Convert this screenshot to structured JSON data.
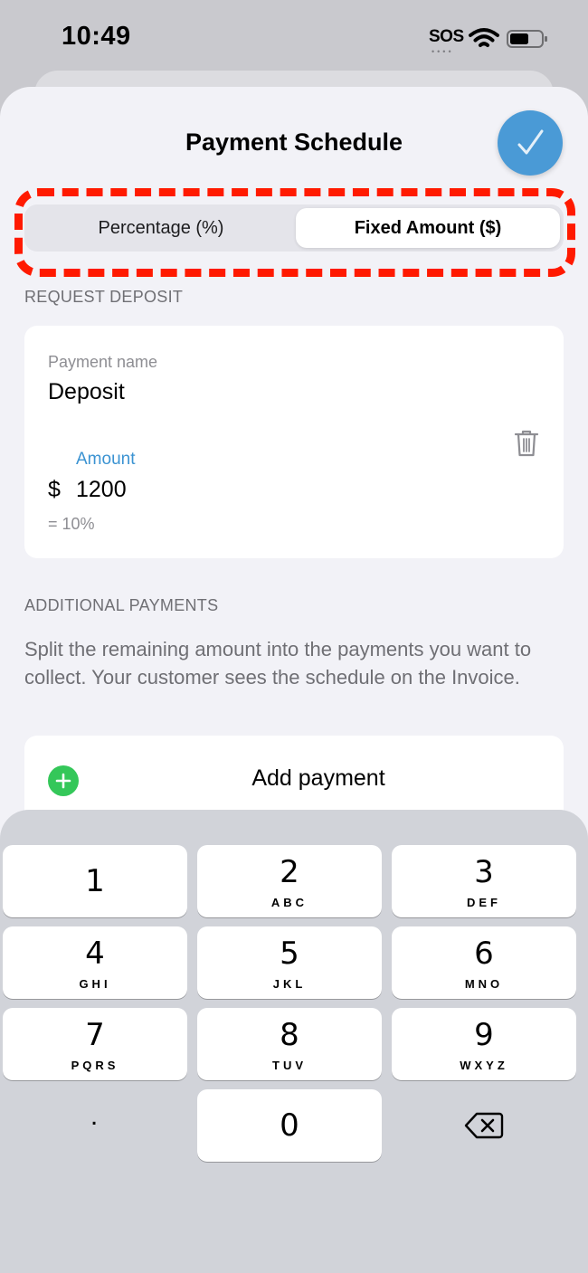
{
  "status_bar": {
    "time": "10:49",
    "sos": "SOS",
    "dots": "••••",
    "wifi_icon": "wifi-icon",
    "battery_icon": "battery-icon"
  },
  "sheet": {
    "title": "Payment Schedule",
    "done_icon": "checkmark-icon",
    "accent_color": "#4a9ad6"
  },
  "segmented_control": {
    "options": [
      "Percentage (%)",
      "Fixed Amount ($)"
    ],
    "selected": "Fixed Amount ($)",
    "highlight_color": "#ff1a00"
  },
  "request_deposit": {
    "header": "REQUEST DEPOSIT",
    "name_label": "Payment name",
    "name_value": "Deposit",
    "amount_label": "Amount",
    "currency": "$",
    "amount_value": "1200",
    "percent_note": "= 10%",
    "delete_icon": "trash-icon"
  },
  "additional_payments": {
    "header": "ADDITIONAL PAYMENTS",
    "description": "Split the remaining amount into the payments you want to collect. Your customer sees the schedule on the Invoice.",
    "add_label": "Add payment",
    "add_icon": "plus-circle-icon",
    "add_color": "#34c759"
  },
  "keypad": {
    "keys": [
      {
        "digit": "1",
        "letters": ""
      },
      {
        "digit": "2",
        "letters": "ABC"
      },
      {
        "digit": "3",
        "letters": "DEF"
      },
      {
        "digit": "4",
        "letters": "GHI"
      },
      {
        "digit": "5",
        "letters": "JKL"
      },
      {
        "digit": "6",
        "letters": "MNO"
      },
      {
        "digit": "7",
        "letters": "PQRS"
      },
      {
        "digit": "8",
        "letters": "TUV"
      },
      {
        "digit": "9",
        "letters": "WXYZ"
      },
      {
        "digit": "0",
        "letters": ""
      }
    ],
    "decimal": ".",
    "backspace_icon": "backspace-icon"
  }
}
